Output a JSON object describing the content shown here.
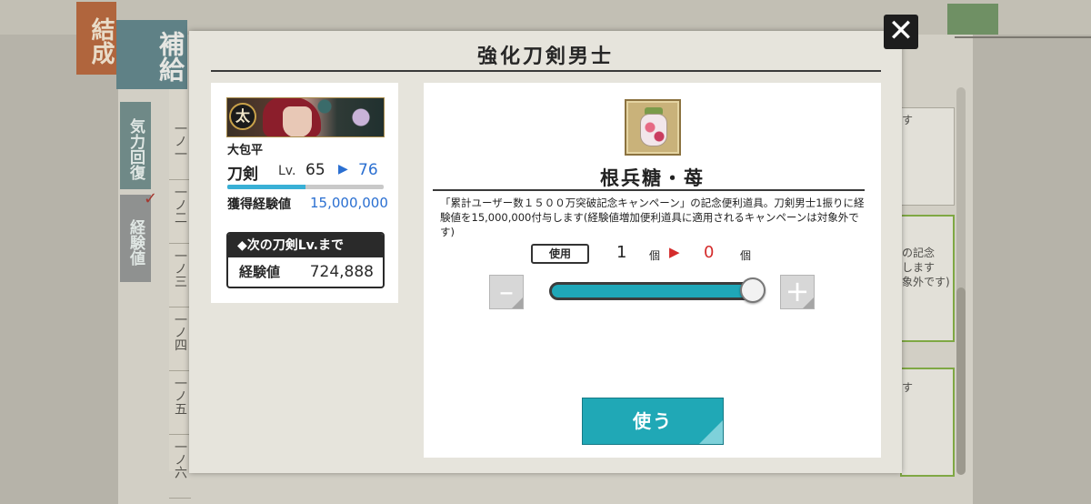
{
  "background": {
    "tab_main": "結成",
    "tab_sub": "補給",
    "side_tabs": [
      "気力回復",
      "経験値"
    ],
    "list_rows": [
      "一ノ一",
      "一ノ二",
      "一ノ三",
      "一ノ四",
      "一ノ五",
      "一ノ六"
    ],
    "right_snippets": [
      "す",
      "の記念\nします\n象外です)",
      "す"
    ]
  },
  "dialog": {
    "title": "強化刀剣男士",
    "close_label": "✕"
  },
  "unit": {
    "badge": "太",
    "name": "大包平",
    "type": "刀剣",
    "lv_label": "Lv.",
    "current_level": "65",
    "arrow": "▶",
    "next_level": "76",
    "level_progress": 0.5,
    "gain_label": "獲得経験値",
    "gain_value": "15,000,000",
    "next_header": "◆次の刀剣Lv.まで",
    "next_label": "経験値",
    "next_value": "724,888"
  },
  "item": {
    "icon": "konpeito-jar-icon",
    "name": "根兵糖・苺",
    "description": "「累計ユーザー数１５００万突破記念キャンペーン」の記念便利道具。刀剣男士1振りに経験値を15,000,000付与します(経験値増加便利道具に適用されるキャンペーンは対象外です)",
    "use_tag": "使用",
    "use_qty": "1",
    "unit": "個",
    "arrow": "▶",
    "remaining": "0",
    "slider_fraction": 1.0,
    "minus_label": "–",
    "plus_label": "+",
    "use_button": "使う"
  },
  "colors": {
    "accent": "#20a8b6",
    "level_blue": "#2a6fd1",
    "remain_red": "#d42b2b"
  }
}
